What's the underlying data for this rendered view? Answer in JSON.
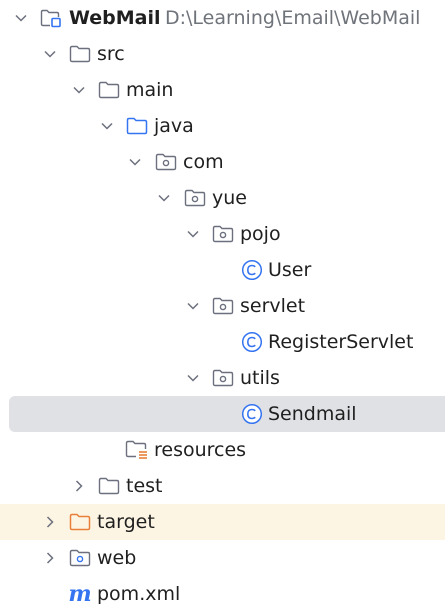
{
  "project": {
    "name": "WebMail",
    "path": "D:\\Learning\\Email\\WebMail"
  },
  "tree": {
    "src": "src",
    "main": "main",
    "java": "java",
    "com": "com",
    "yue": "yue",
    "pojo": "pojo",
    "user": "User",
    "servlet": "servlet",
    "register_servlet": "RegisterServlet",
    "utils": "utils",
    "sendmail": "Sendmail",
    "resources": "resources",
    "test": "test",
    "target": "target",
    "web": "web",
    "pom": "pom.xml"
  },
  "icons": {
    "chevron_expanded": "chevron-down-icon",
    "chevron_collapsed": "chevron-right-icon",
    "module": "module-icon",
    "folder": "folder-icon",
    "source_root": "source-root-icon",
    "package": "package-icon",
    "class": "java-class-icon",
    "resources_root": "resources-root-icon",
    "excluded": "excluded-folder-icon",
    "web": "web-folder-icon",
    "maven": "maven-icon",
    "maven_glyph": "m"
  },
  "colors": {
    "selected_row": "#dfe1e5",
    "excluded_row": "#fdf5e3",
    "source_root_blue": "#3574f0",
    "class_blue": "#3574f0",
    "excluded_orange": "#e8803a",
    "resources_orange": "#e8803a",
    "path_gray": "#6f737a"
  }
}
